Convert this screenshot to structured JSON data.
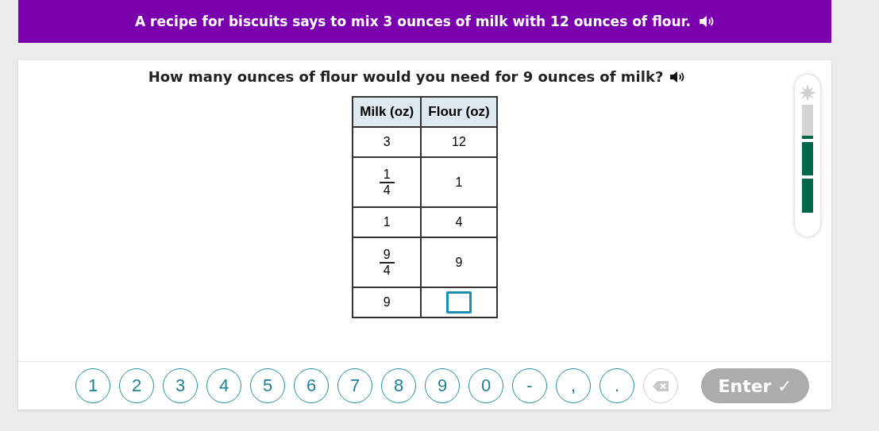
{
  "banner": {
    "text": "A recipe for biscuits says to mix 3 ounces of milk with 12 ounces of flour."
  },
  "question": {
    "text": "How many ounces of flour would you need for 9 ounces of milk?"
  },
  "table": {
    "columns": [
      "Milk (oz)",
      "Flour (oz)"
    ],
    "rows": [
      [
        {
          "kind": "number",
          "text": "3"
        },
        {
          "kind": "number",
          "text": "12"
        }
      ],
      [
        {
          "kind": "fraction",
          "numerator": "1",
          "denominator": "4"
        },
        {
          "kind": "number",
          "text": "1"
        }
      ],
      [
        {
          "kind": "number",
          "text": "1"
        },
        {
          "kind": "number",
          "text": "4"
        }
      ],
      [
        {
          "kind": "fraction",
          "numerator": "9",
          "denominator": "4"
        },
        {
          "kind": "number",
          "text": "9"
        }
      ],
      [
        {
          "kind": "number",
          "text": "9"
        },
        {
          "kind": "answer"
        }
      ]
    ]
  },
  "progress": {
    "level": 0.72
  },
  "keypad": {
    "keys": [
      "1",
      "2",
      "3",
      "4",
      "5",
      "6",
      "7",
      "8",
      "9",
      "0",
      "-",
      ",",
      "."
    ],
    "backspace_disabled": true,
    "enter": {
      "label": "Enter ✓",
      "disabled": true
    }
  }
}
